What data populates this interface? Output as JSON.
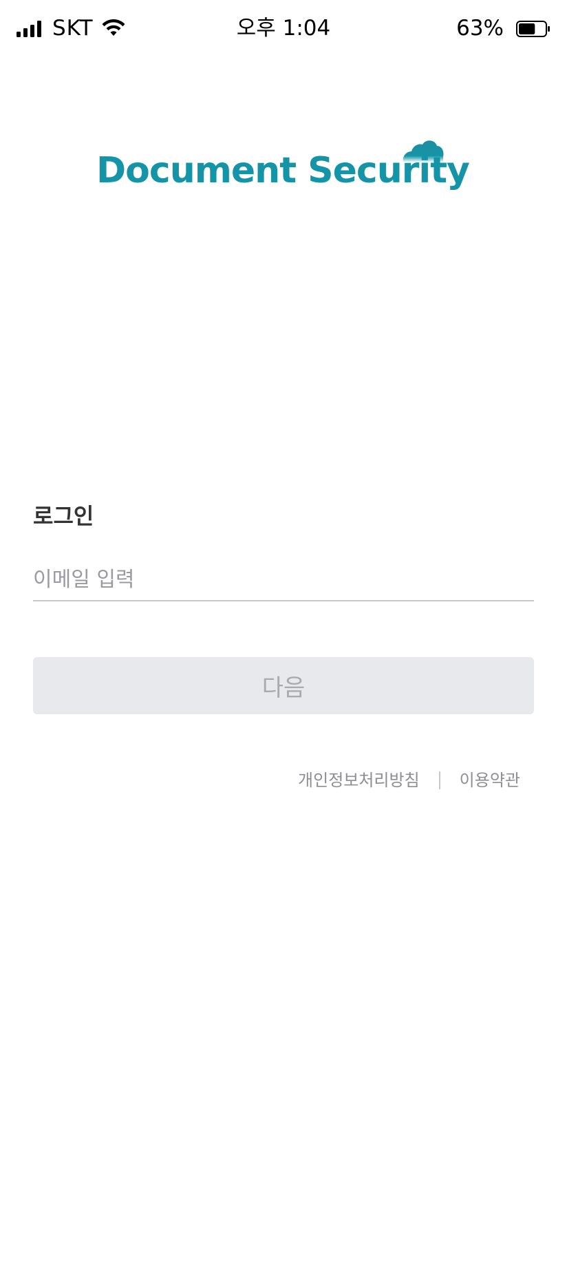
{
  "status_bar": {
    "carrier": "SKT",
    "time": "오후 1:04",
    "battery_percent": "63%",
    "battery_level": 0.63,
    "icons": [
      "signal-icon",
      "wifi-icon",
      "battery-icon"
    ]
  },
  "logo": {
    "text": "Document Security",
    "icon": "cloud-icon",
    "color": "#1494a6"
  },
  "login": {
    "title": "로그인",
    "email_placeholder": "이메일 입력",
    "email_value": "",
    "next_label": "다음",
    "next_enabled": false
  },
  "footer": {
    "privacy_label": "개인정보처리방침",
    "terms_label": "이용약관"
  }
}
